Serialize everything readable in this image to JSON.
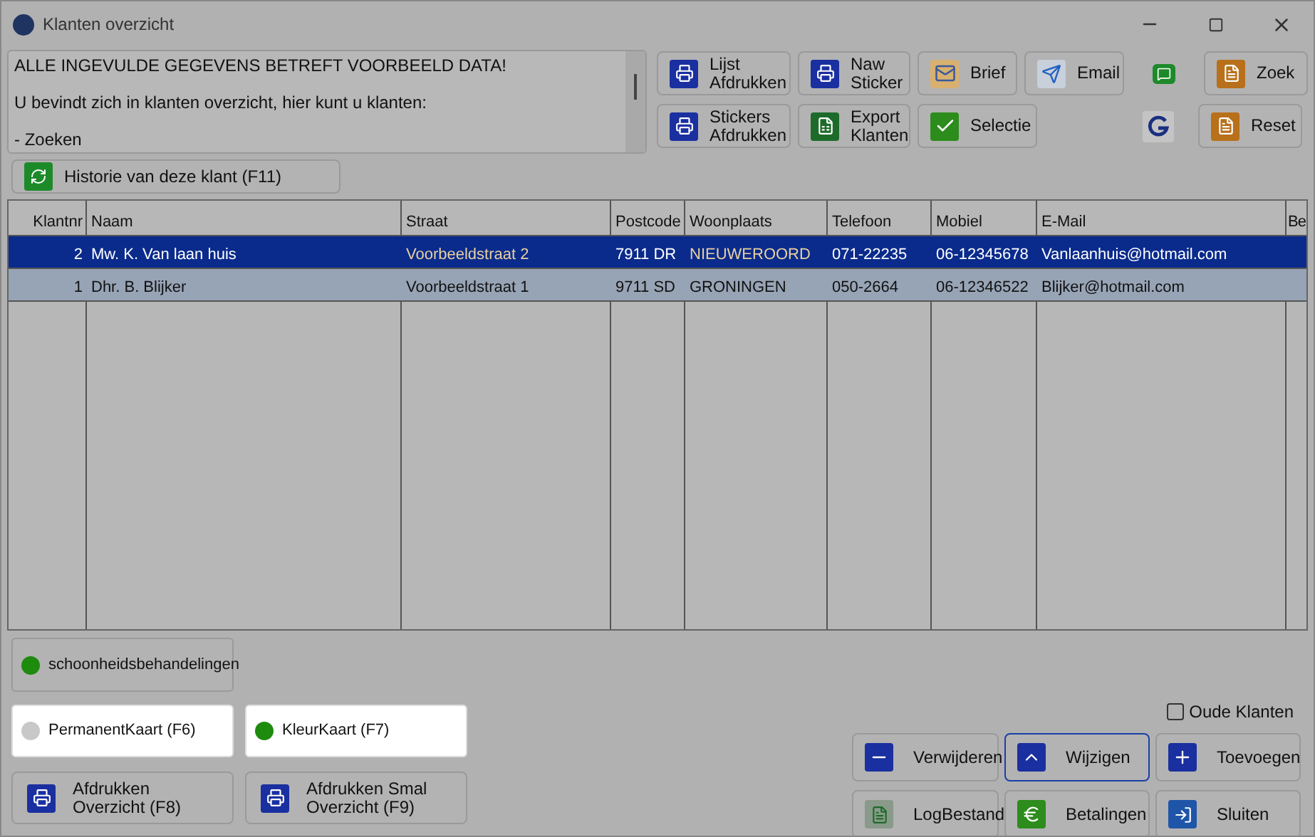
{
  "window": {
    "title": "Klanten overzicht"
  },
  "memo": {
    "lines": [
      "ALLE INGEVULDE GEGEVENS BETREFT VOORBEELD DATA!",
      "U bevindt zich in klanten overzicht, hier kunt u klanten:",
      "- Zoeken"
    ]
  },
  "toolbar": {
    "row_1": [
      {
        "label": "Lijst Afdrukken"
      },
      {
        "label": "Naw Sticker"
      },
      {
        "label": "Brief"
      },
      {
        "label": "Email"
      },
      {
        "label": "Zoek"
      }
    ],
    "row_2": [
      {
        "label": "Stickers Afdrukken"
      },
      {
        "label": "Export Klanten"
      },
      {
        "label": "Selectie"
      },
      {
        "label": "Reset"
      }
    ]
  },
  "history_button": {
    "label": "Historie van deze klant (F11)"
  },
  "table": {
    "columns": [
      "Klantnr",
      "Naam",
      "Straat",
      "Postcode",
      "Woonplaats",
      "Telefoon",
      "Mobiel",
      "E-Mail",
      "Be"
    ],
    "rows": [
      {
        "selected": true,
        "highlighted": false,
        "cells": [
          "2",
          "Mw. K. Van  laan huis",
          "Voorbeeldstraat 2",
          "7911 DR",
          "NIEUWEROORD",
          "071-22235",
          "06-12345678",
          "Vanlaanhuis@hotmail.com"
        ]
      },
      {
        "selected": false,
        "highlighted": true,
        "cells": [
          "1",
          "Dhr. B. Blijker",
          "Voorbeeldstraat 1",
          "9711 SD",
          "GRONINGEN",
          "050-2664",
          "06-12346522",
          "Blijker@hotmail.com"
        ]
      }
    ]
  },
  "toggles": [
    {
      "label": "schoonheidsbehandelingen",
      "on": true,
      "white": false
    },
    {
      "label": "PermanentKaart (F6)",
      "on": false,
      "white": true
    },
    {
      "label": "KleurKaart (F7)",
      "on": true,
      "white": true
    }
  ],
  "print_buttons": [
    {
      "label": "Afdrukken Overzicht (F8)"
    },
    {
      "label": "Afdrukken Smal Overzicht (F9)"
    }
  ],
  "old_customers": {
    "label": "Oude Klanten",
    "checked": false
  },
  "actions": [
    {
      "label": "Verwijderen",
      "focused": false
    },
    {
      "label": "Wijzigen",
      "focused": true
    },
    {
      "label": "Toevoegen",
      "focused": false
    },
    {
      "label": "LogBestand",
      "focused": false
    },
    {
      "label": "Betalingen",
      "focused": false
    },
    {
      "label": "Sluiten",
      "focused": false
    }
  ]
}
